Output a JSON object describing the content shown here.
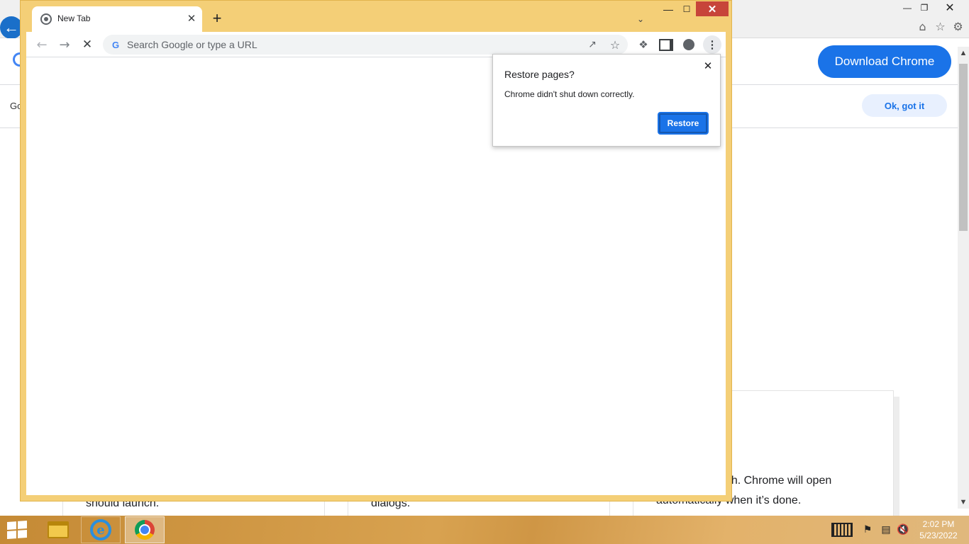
{
  "background_page": {
    "download_button": "Download Chrome",
    "notice_prefix": "Go",
    "ok_button": "Ok, got it",
    "card1_text": "should launch.",
    "card2_text": "dialogs.",
    "card3_text": "tallation to finish. Chrome will open automatically when it’s done."
  },
  "chrome": {
    "tab_title": "New Tab",
    "omnibox_placeholder": "Search Google or type a URL",
    "frame_color": "#f4cf77",
    "close_color": "#c7453a"
  },
  "popup": {
    "title": "Restore pages?",
    "message": "Chrome didn't shut down correctly.",
    "restore_button": "Restore",
    "accent": "#1a73e8"
  },
  "taskbar": {
    "time": "2:02 PM",
    "date": "5/23/2022"
  }
}
